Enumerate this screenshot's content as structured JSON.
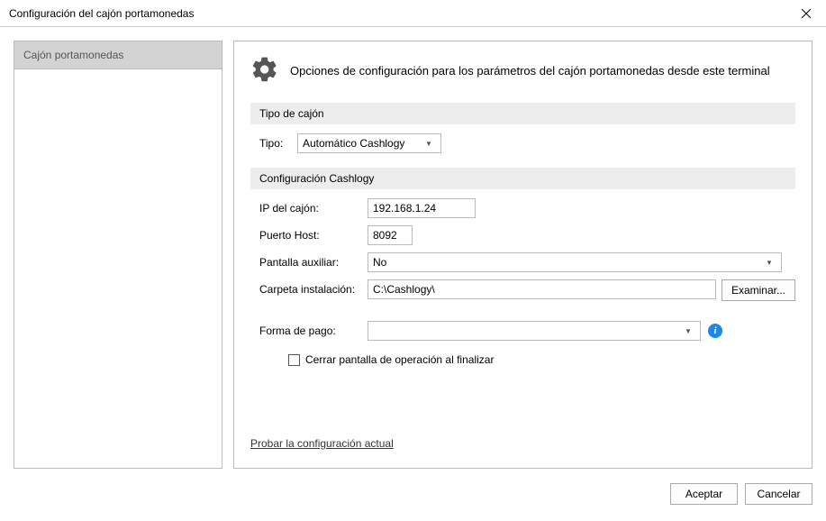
{
  "window": {
    "title": "Configuración del cajón portamonedas"
  },
  "sidebar": {
    "items": [
      {
        "label": "Cajón portamonedas"
      }
    ]
  },
  "main": {
    "header": "Opciones de configuración para los parámetros del cajón portamonedas desde este terminal",
    "section_tipo": {
      "title": "Tipo de cajón",
      "tipo_label": "Tipo:",
      "tipo_value": "Automático Cashlogy"
    },
    "section_cashlogy": {
      "title": "Configuración Cashlogy",
      "ip_label": "IP del cajón:",
      "ip_value": "192.168.1.24",
      "port_label": "Puerto Host:",
      "port_value": "8092",
      "pantalla_label": "Pantalla auxiliar:",
      "pantalla_value": "No",
      "carpeta_label": "Carpeta instalación:",
      "carpeta_value": "C:\\Cashlogy\\",
      "examinar_label": "Examinar...",
      "pago_label": "Forma de pago:",
      "pago_value": "",
      "cerrar_label": "Cerrar pantalla de operación al finalizar"
    },
    "test_link": "Probar la configuración actual"
  },
  "footer": {
    "accept": "Aceptar",
    "cancel": "Cancelar"
  }
}
